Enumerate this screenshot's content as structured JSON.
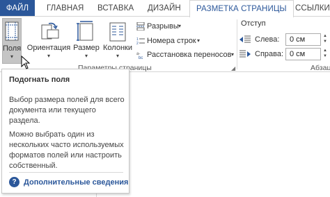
{
  "tabs": {
    "file": "ФАЙЛ",
    "home": "ГЛАВНАЯ",
    "insert": "ВСТАВКА",
    "design": "ДИЗАЙН",
    "layout": "РАЗМЕТКА СТРАНИЦЫ",
    "links": "ССЫЛКИ"
  },
  "ribbon": {
    "page_setup": {
      "fields": "Поля",
      "orientation": "Ориентация",
      "size": "Размер",
      "columns": "Колонки",
      "breaks": "Разрывы",
      "line_numbers": "Номера строк",
      "hyphenation": "Расстановка переносов",
      "group_label": "Параметры страницы"
    },
    "indent": {
      "title": "Отступ",
      "left_label": "Слева:",
      "left_value": "0 см",
      "right_label": "Справа:",
      "right_value": "0 см",
      "group_label": "Абзац"
    }
  },
  "tooltip": {
    "title": "Подогнать поля",
    "paragraph1": "Выбор размера полей для всего документа или текущего раздела.",
    "paragraph2": "Можно выбрать один из нескольких часто используемых форматов полей или настроить собственный.",
    "link": "Дополнительные сведения",
    "help_glyph": "?"
  },
  "colors": {
    "accent": "#2b579a",
    "pressed_button": "#c5c5c5"
  },
  "icons": [
    "fields-icon",
    "orientation-icon",
    "size-icon",
    "columns-icon",
    "breaks-icon",
    "line-numbers-icon",
    "hyphenation-icon",
    "indent-left-icon",
    "indent-right-icon",
    "help-icon",
    "mouse-cursor-icon"
  ]
}
